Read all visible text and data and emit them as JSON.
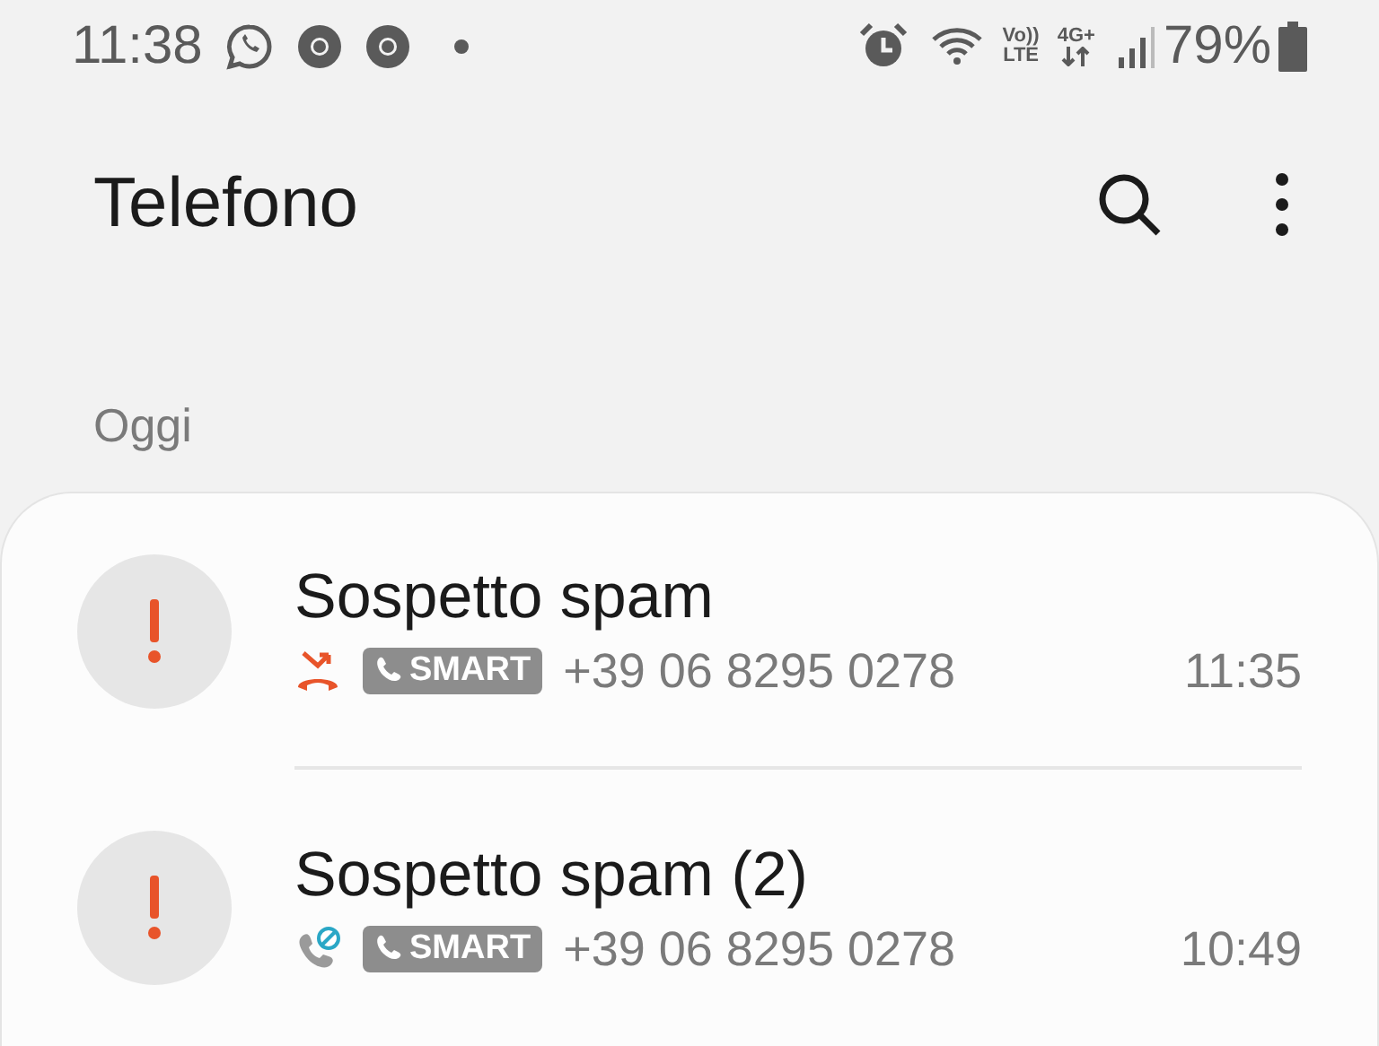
{
  "status_bar": {
    "time": "11:38",
    "volte_top": "Vo))",
    "volte_bottom": "LTE",
    "network": "4G+",
    "battery": "79%"
  },
  "app_bar": {
    "title": "Telefono"
  },
  "section": {
    "label": "Oggi"
  },
  "calls": [
    {
      "name": "Sospetto spam",
      "kind": "missed",
      "badge": "SMART",
      "number": "+39 06 8295 0278",
      "time": "11:35"
    },
    {
      "name": "Sospetto spam (2)",
      "kind": "blocked",
      "badge": "SMART",
      "number": "+39 06 8295 0278",
      "time": "10:49"
    }
  ]
}
